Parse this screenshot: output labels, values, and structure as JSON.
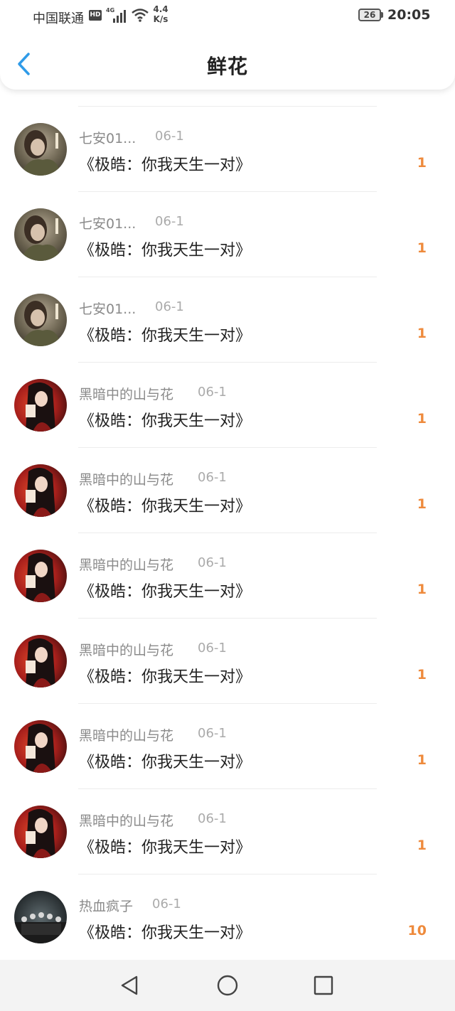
{
  "status_bar": {
    "carrier": "中国联通",
    "hd_badge": "HD",
    "network_type": "4G",
    "net_speed_value": "4.4",
    "net_speed_unit": "K/s",
    "battery": "26",
    "time": "20:05"
  },
  "header": {
    "title": "鲜花",
    "back_icon": "back-chevron-icon"
  },
  "items": [
    {
      "username": "七安01...",
      "date": "06-1",
      "book": "《极皓：你我天生一对》",
      "count": "1",
      "avatar": "girl-scarf"
    },
    {
      "username": "七安01...",
      "date": "06-1",
      "book": "《极皓：你我天生一对》",
      "count": "1",
      "avatar": "girl-scarf"
    },
    {
      "username": "七安01...",
      "date": "06-1",
      "book": "《极皓：你我天生一对》",
      "count": "1",
      "avatar": "girl-scarf"
    },
    {
      "username": "黑暗中的山与花",
      "date": "06-1",
      "book": "《极皓：你我天生一对》",
      "count": "1",
      "avatar": "anime-red"
    },
    {
      "username": "黑暗中的山与花",
      "date": "06-1",
      "book": "《极皓：你我天生一对》",
      "count": "1",
      "avatar": "anime-red"
    },
    {
      "username": "黑暗中的山与花",
      "date": "06-1",
      "book": "《极皓：你我天生一对》",
      "count": "1",
      "avatar": "anime-red"
    },
    {
      "username": "黑暗中的山与花",
      "date": "06-1",
      "book": "《极皓：你我天生一对》",
      "count": "1",
      "avatar": "anime-red"
    },
    {
      "username": "黑暗中的山与花",
      "date": "06-1",
      "book": "《极皓：你我天生一对》",
      "count": "1",
      "avatar": "anime-red"
    },
    {
      "username": "黑暗中的山与花",
      "date": "06-1",
      "book": "《极皓：你我天生一对》",
      "count": "1",
      "avatar": "anime-red"
    },
    {
      "username": "热血疯子",
      "date": "06-1",
      "book": "《极皓：你我天生一对》",
      "count": "10",
      "avatar": "group-dark"
    }
  ],
  "nav_bar": {
    "back_icon": "nav-back-triangle-icon",
    "home_icon": "nav-home-circle-icon",
    "recents_icon": "nav-recents-square-icon"
  },
  "colors": {
    "accent_blue": "#2f9be8",
    "count_orange": "#ee8a3c",
    "username_gray": "#8a8a8a",
    "date_gray": "#aaaaaa"
  }
}
